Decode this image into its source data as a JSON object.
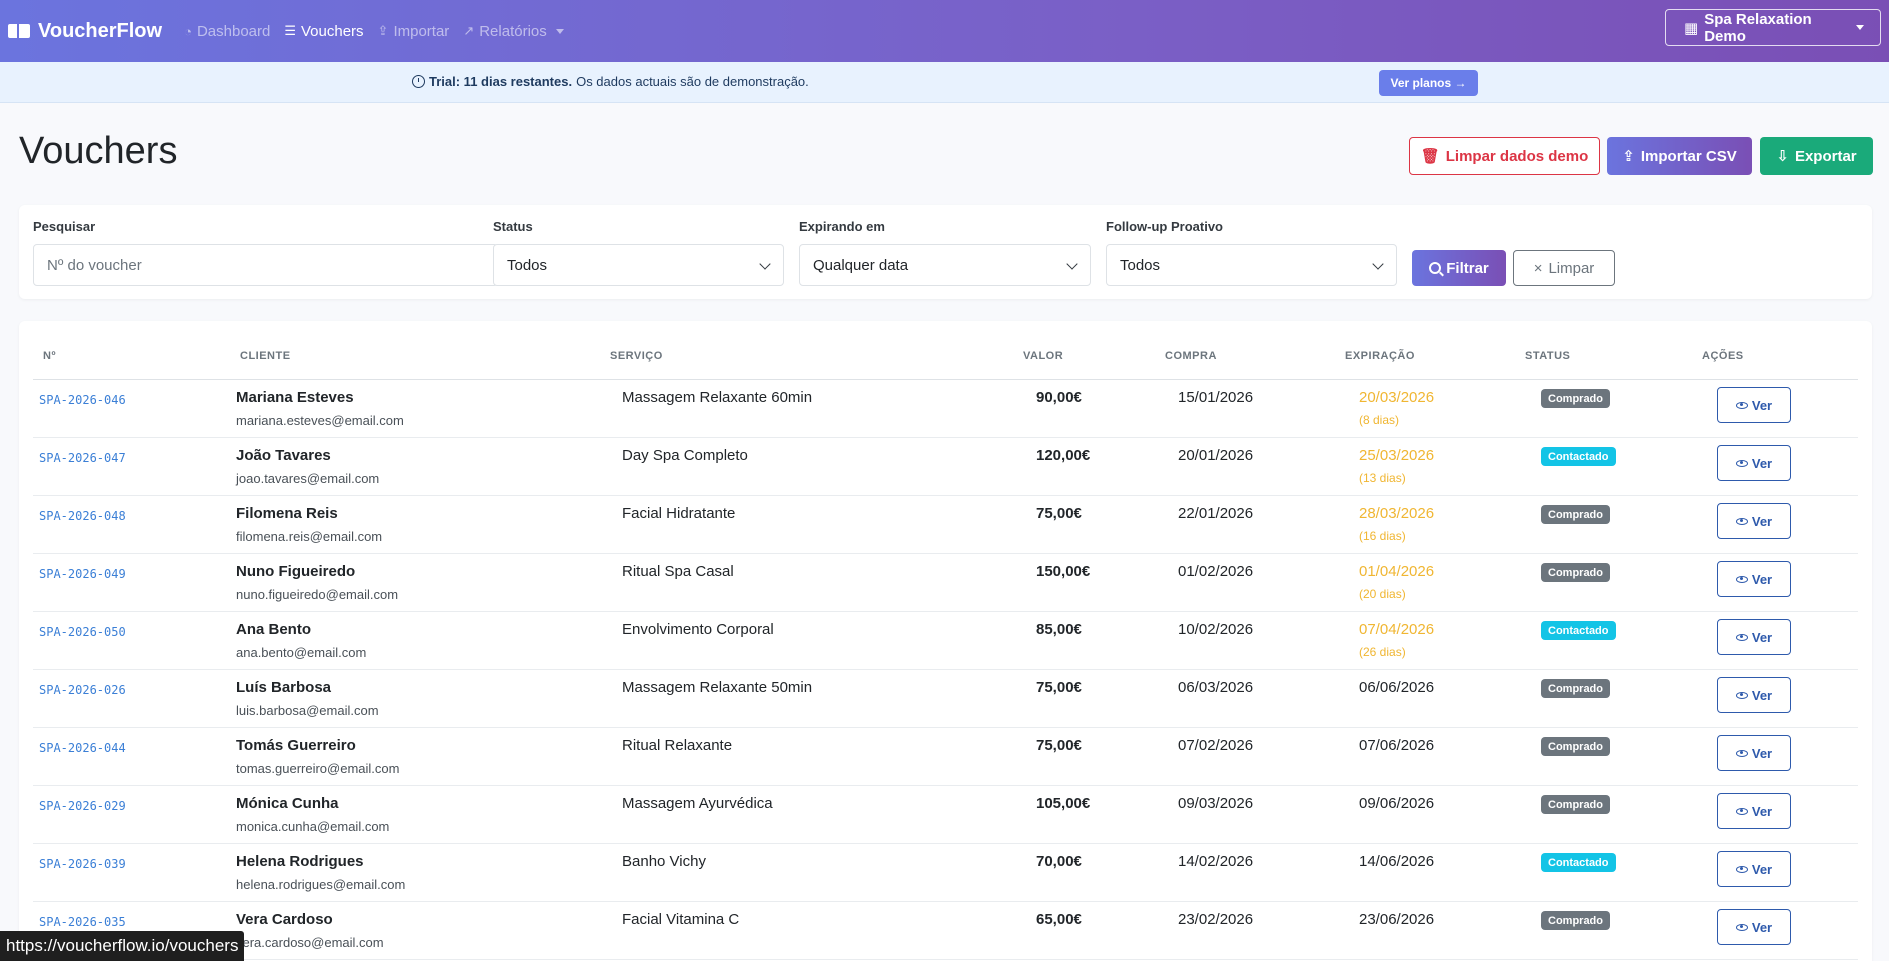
{
  "nav": {
    "brand": "VoucherFlow",
    "links": [
      {
        "label": "Dashboard",
        "icon": "gauge-icon",
        "active": false
      },
      {
        "label": "Vouchers",
        "icon": "list-icon",
        "active": true
      },
      {
        "label": "Importar",
        "icon": "upload-icon",
        "active": false
      },
      {
        "label": "Relatórios",
        "icon": "chart-icon",
        "active": false
      }
    ],
    "account": "Spa Relaxation Demo"
  },
  "trial": {
    "bold": "Trial: 11 dias restantes.",
    "text": "Os dados actuais são de demonstração.",
    "button": "Ver planos →"
  },
  "page": {
    "title": "Vouchers",
    "clear_demo": "Limpar dados demo",
    "import_csv": "Importar CSV",
    "export": "Exportar"
  },
  "filters": {
    "search_label": "Pesquisar",
    "search_placeholder": "Nº do voucher",
    "status_label": "Status",
    "status_value": "Todos",
    "expiring_label": "Expirando em",
    "expiring_value": "Qualquer data",
    "followup_label": "Follow-up Proativo",
    "followup_value": "Todos",
    "filter_button": "Filtrar",
    "reset_button": "Limpar"
  },
  "table": {
    "columns": [
      "Nº",
      "CLIENTE",
      "SERVIÇO",
      "VALOR",
      "COMPRA",
      "EXPIRAÇÃO",
      "STATUS",
      "AÇÕES"
    ],
    "action_label": "Ver",
    "rows": [
      {
        "no": "SPA-2026-046",
        "name": "Mariana Esteves",
        "email": "mariana.esteves@email.com",
        "service": "Massagem Relaxante 60min",
        "value": "90,00€",
        "purchase": "15/01/2026",
        "expiry": "20/03/2026",
        "days": "(8 dias)",
        "status": "Comprado"
      },
      {
        "no": "SPA-2026-047",
        "name": "João Tavares",
        "email": "joao.tavares@email.com",
        "service": "Day Spa Completo",
        "value": "120,00€",
        "purchase": "20/01/2026",
        "expiry": "25/03/2026",
        "days": "(13 dias)",
        "status": "Contactado"
      },
      {
        "no": "SPA-2026-048",
        "name": "Filomena Reis",
        "email": "filomena.reis@email.com",
        "service": "Facial Hidratante",
        "value": "75,00€",
        "purchase": "22/01/2026",
        "expiry": "28/03/2026",
        "days": "(16 dias)",
        "status": "Comprado"
      },
      {
        "no": "SPA-2026-049",
        "name": "Nuno Figueiredo",
        "email": "nuno.figueiredo@email.com",
        "service": "Ritual Spa Casal",
        "value": "150,00€",
        "purchase": "01/02/2026",
        "expiry": "01/04/2026",
        "days": "(20 dias)",
        "status": "Comprado"
      },
      {
        "no": "SPA-2026-050",
        "name": "Ana Bento",
        "email": "ana.bento@email.com",
        "service": "Envolvimento Corporal",
        "value": "85,00€",
        "purchase": "10/02/2026",
        "expiry": "07/04/2026",
        "days": "(26 dias)",
        "status": "Contactado"
      },
      {
        "no": "SPA-2026-026",
        "name": "Luís Barbosa",
        "email": "luis.barbosa@email.com",
        "service": "Massagem Relaxante 50min",
        "value": "75,00€",
        "purchase": "06/03/2026",
        "expiry": "06/06/2026",
        "days": "",
        "status": "Comprado"
      },
      {
        "no": "SPA-2026-044",
        "name": "Tomás Guerreiro",
        "email": "tomas.guerreiro@email.com",
        "service": "Ritual Relaxante",
        "value": "75,00€",
        "purchase": "07/02/2026",
        "expiry": "07/06/2026",
        "days": "",
        "status": "Comprado"
      },
      {
        "no": "SPA-2026-029",
        "name": "Mónica Cunha",
        "email": "monica.cunha@email.com",
        "service": "Massagem Ayurvédica",
        "value": "105,00€",
        "purchase": "09/03/2026",
        "expiry": "09/06/2026",
        "days": "",
        "status": "Comprado"
      },
      {
        "no": "SPA-2026-039",
        "name": "Helena Rodrigues",
        "email": "helena.rodrigues@email.com",
        "service": "Banho Vichy",
        "value": "70,00€",
        "purchase": "14/02/2026",
        "expiry": "14/06/2026",
        "days": "",
        "status": "Contactado"
      },
      {
        "no": "SPA-2026-035",
        "name": "Vera Cardoso",
        "email": "vera.cardoso@email.com",
        "service": "Facial Vitamina C",
        "value": "65,00€",
        "purchase": "23/02/2026",
        "expiry": "23/06/2026",
        "days": "",
        "status": "Comprado"
      }
    ]
  },
  "statusbar": {
    "url": "https://voucherflow.io/vouchers"
  },
  "colors": {
    "accent": "#6b74de",
    "warning": "#f0b632",
    "success": "#1aaa7a",
    "danger": "#dc3545",
    "info": "#13c4e6",
    "secondary": "#6c757d"
  }
}
